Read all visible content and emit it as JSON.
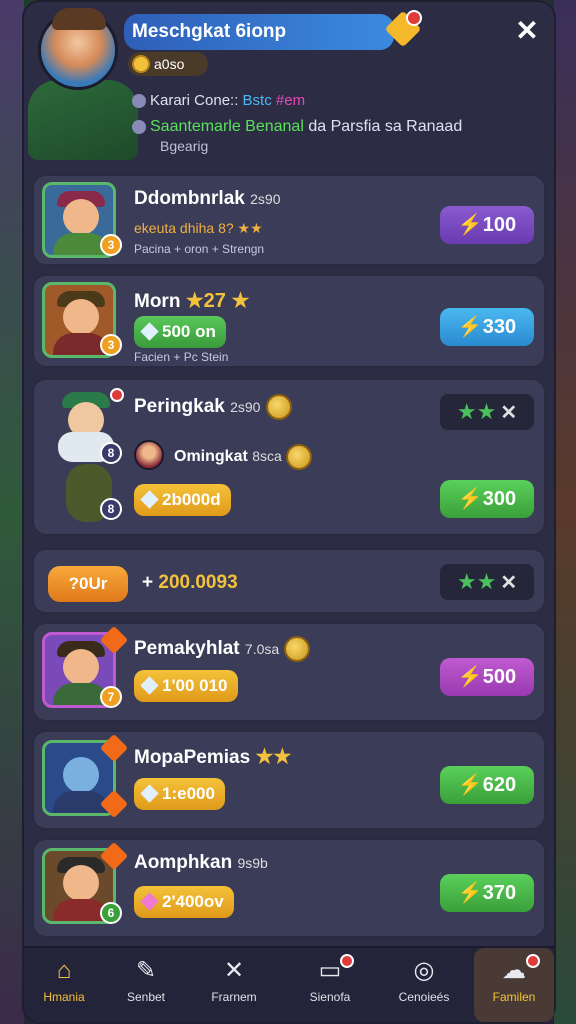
{
  "header": {
    "title": "Meschgkat 6ionp",
    "coins": "a0so",
    "info_line1_prefix": "Karari Cone::",
    "info_line1_hl": "Bstc",
    "info_line1_hl2": "#em",
    "info_line2_green": "Saantemarle Benanal",
    "info_line2_rest": "da Parsfia sa Ranaad",
    "info_line3": "Bgearig",
    "close_label": "✕"
  },
  "cards": [
    {
      "name": "Ddombnrlak",
      "name_suffix": "2s90",
      "sub": "ekeuta dhiha 8? ★★",
      "sub2": "Pacina + oron + Strengn",
      "level": "3",
      "price": "⚡100",
      "price_color": "#8a5ad0"
    },
    {
      "name": "Morn",
      "name_suffix": "★27 ★",
      "reward": "500 on",
      "sub2": "Facien + Pc Stein",
      "level": "3",
      "price": "⚡330",
      "price_color": "#4ab8f0"
    },
    {
      "name": "Peringkak",
      "name_suffix": "2s90",
      "second_name": "Omingkat",
      "second_suffix": "8sca",
      "reward": "2b000d",
      "level": "8",
      "price": "⚡300",
      "price_color": "#5ad05a",
      "action_x": "✕"
    },
    {
      "name": "Pemakyhlat",
      "name_suffix": "7.0sa",
      "reward": "1'00 010",
      "level": "7",
      "price": "⚡500",
      "price_color": "#c05ad0"
    },
    {
      "name": "MopaPemias",
      "name_suffix": "★★",
      "reward": "1:e000",
      "price": "⚡620",
      "price_color": "#5ad05a"
    },
    {
      "name": "Aomphkan",
      "name_suffix": "9s9b",
      "reward": "2'400ov",
      "level": "6",
      "price": "⚡370",
      "price_color": "#5ad05a"
    }
  ],
  "bonus": {
    "pill": "?0Ur",
    "prefix": "+",
    "value": "200.0093",
    "action_x": "✕"
  },
  "nav": [
    {
      "label": "Hmania",
      "icon": "home-icon"
    },
    {
      "label": "Senbet",
      "icon": "edit-icon"
    },
    {
      "label": "Frarnem",
      "icon": "cross-swords-icon"
    },
    {
      "label": "Sienofa",
      "icon": "shop-icon"
    },
    {
      "label": "Cenoieés",
      "icon": "target-icon"
    },
    {
      "label": "Familen",
      "icon": "cloud-icon"
    }
  ],
  "colors": {
    "panel": "#2c2d45",
    "card": "#3b3c58",
    "accent_gold": "#f4c23a",
    "accent_green": "#5ad05a"
  }
}
